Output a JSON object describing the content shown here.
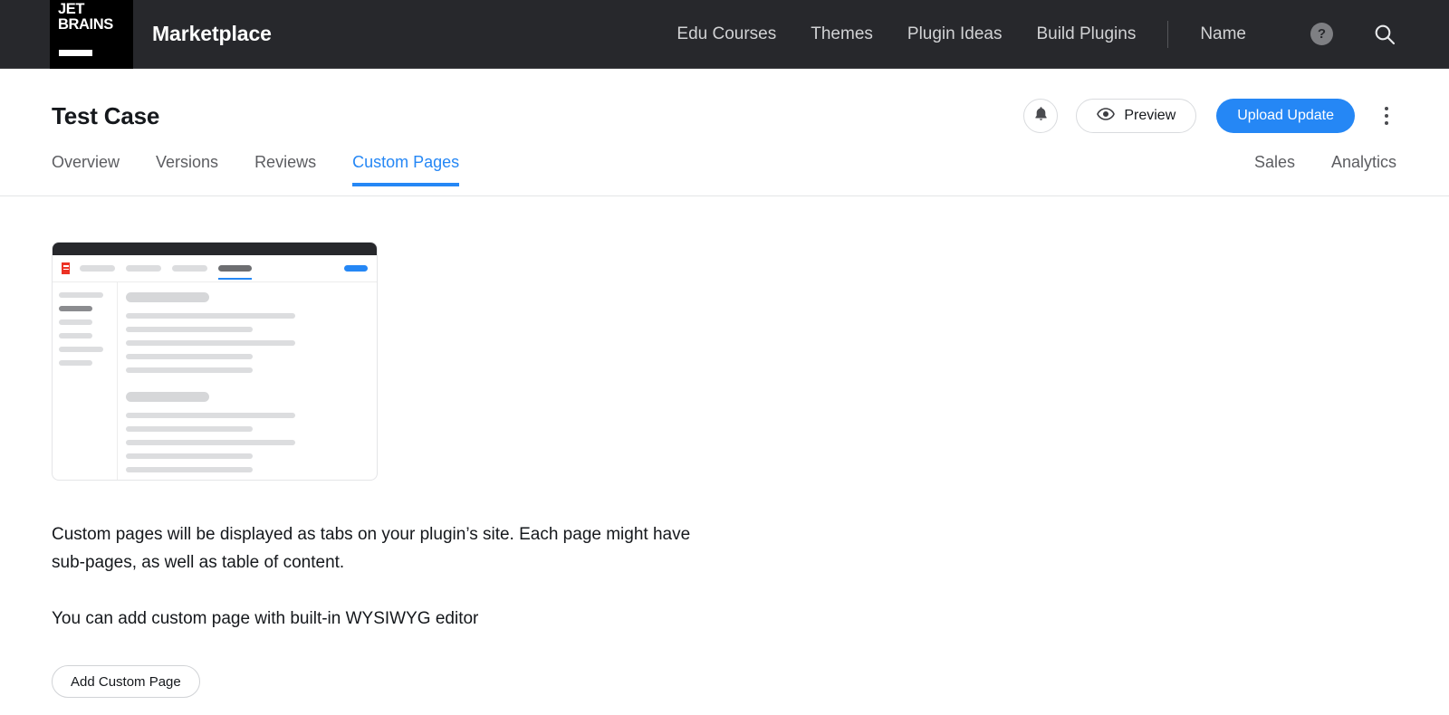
{
  "topbar": {
    "logo_line1": "JET",
    "logo_line2": "BRAINS",
    "logo_name": "jetbrains-logo",
    "brand": "Marketplace",
    "nav": [
      {
        "label": "Edu Courses",
        "name": "nav-link-edu-courses"
      },
      {
        "label": "Themes",
        "name": "nav-link-themes"
      },
      {
        "label": "Plugin Ideas",
        "name": "nav-link-plugin-ideas"
      },
      {
        "label": "Build Plugins",
        "name": "nav-link-build-plugins"
      }
    ],
    "account": "Name",
    "help_glyph": "?",
    "help_icon": "question-mark-icon",
    "search_icon": "search-icon"
  },
  "header": {
    "title": "Test Case",
    "bell_icon": "bell-icon",
    "preview_label": "Preview",
    "preview_icon": "eye-icon",
    "upload_label": "Upload Update",
    "kebab_icon": "more-vertical-icon"
  },
  "tabs": {
    "left": [
      {
        "label": "Overview",
        "name": "tab-overview",
        "active": false
      },
      {
        "label": "Versions",
        "name": "tab-versions",
        "active": false
      },
      {
        "label": "Reviews",
        "name": "tab-reviews",
        "active": false
      },
      {
        "label": "Custom Pages",
        "name": "tab-custom-pages",
        "active": true
      }
    ],
    "right": [
      {
        "label": "Sales",
        "name": "tab-sales",
        "active": false
      },
      {
        "label": "Analytics",
        "name": "tab-analytics",
        "active": false
      }
    ]
  },
  "main": {
    "paragraph_1": "Custom pages will be displayed as tabs on your plugin’s site. Each page might have sub-pages, as well as table of content.",
    "paragraph_2": "You can add custom page with built-in WYSIWYG editor",
    "add_button": "Add Custom Page"
  },
  "colors": {
    "accent_blue": "#2587f5",
    "topbar_bg": "#27282c",
    "logo_bg": "#000000",
    "text_dark": "#15181c",
    "text_muted": "#5c5d61",
    "illus_logo_red": "#ec3225"
  }
}
